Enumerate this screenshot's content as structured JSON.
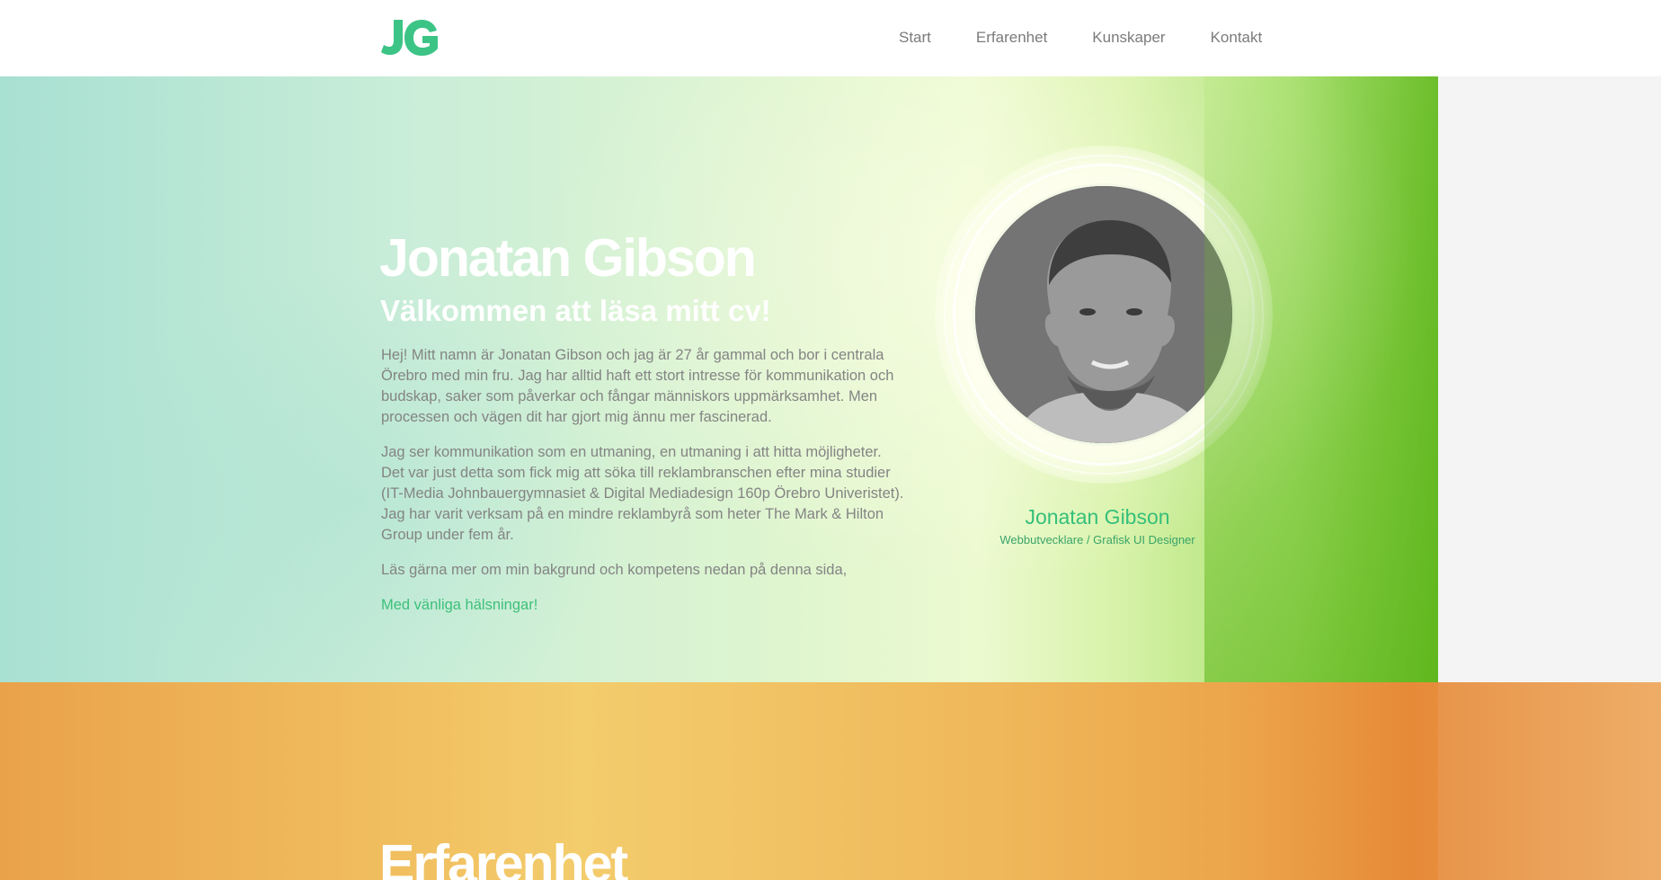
{
  "header": {
    "logo_text": "JG",
    "nav": [
      {
        "label": "Start"
      },
      {
        "label": "Erfarenhet"
      },
      {
        "label": "Kunskaper"
      },
      {
        "label": "Kontakt"
      }
    ]
  },
  "hero": {
    "title": "Jonatan Gibson",
    "subtitle": "Välkommen att läsa mitt cv!",
    "paragraphs": [
      "Hej! Mitt namn är Jonatan Gibson och jag är 27 år gammal och bor i centrala Örebro med min fru. Jag har alltid haft ett stort intresse för kommunikation och budskap, saker som påverkar och fångar människors uppmärksamhet. Men processen och vägen dit har gjort mig ännu mer fascinerad.",
      "Jag ser kommunikation som en utmaning, en utmaning i att hitta möjligheter. Det var just detta som fick mig att söka till reklambranschen efter mina studier (IT-Media Johnbauergymnasiet & Digital Mediadesign 160p Örebro Univeristet). Jag har varit verksam på en mindre reklambyrå som heter The Mark & Hilton Group under fem år.",
      "Läs gärna mer om min bakgrund och kompetens nedan på denna sida,"
    ],
    "greeting": "Med vänliga hälsningar!",
    "profile_name": "Jonatan Gibson",
    "profile_role": "Webbutvecklare / Grafisk UI Designer"
  },
  "experience": {
    "title": "Erfarenhet"
  },
  "colors": {
    "accent_green": "#35bf7a",
    "hero_gradient_start": "#a8e0d2",
    "hero_gradient_end": "#68bb28",
    "experience_orange": "#f1c060"
  }
}
